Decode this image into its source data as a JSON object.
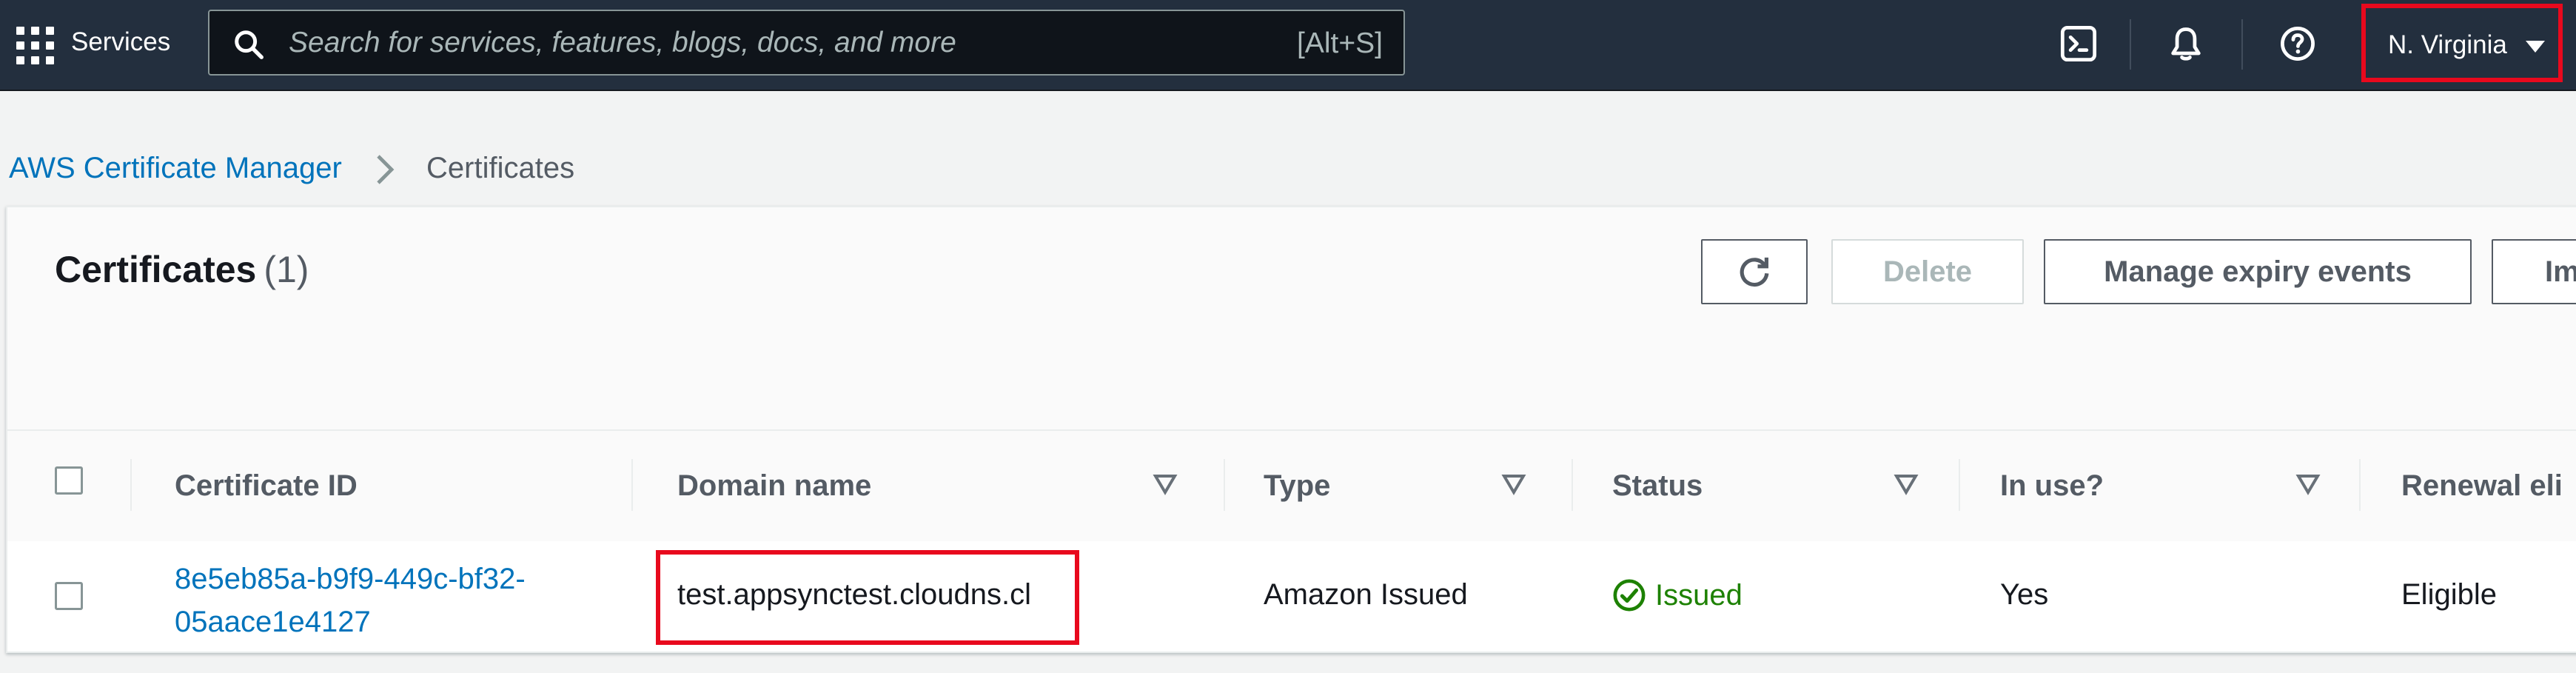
{
  "topnav": {
    "services_label": "Services",
    "search": {
      "placeholder": "Search for services, features, blogs, docs, and more",
      "shortcut": "[Alt+S]"
    },
    "icons": [
      "cloudshell-icon",
      "bell-icon",
      "help-icon"
    ],
    "region": "N. Virginia",
    "highlight_color": "#e8091d"
  },
  "breadcrumb": {
    "parent": "AWS Certificate Manager",
    "current": "Certificates"
  },
  "certificates": {
    "title": "Certificates",
    "count": "(1)",
    "buttons": {
      "delete": "Delete",
      "manage_expiry": "Manage expiry events",
      "import": "Im"
    },
    "columns": {
      "certificate_id": "Certificate ID",
      "domain_name": "Domain name",
      "type": "Type",
      "status": "Status",
      "in_use": "In use?",
      "renewal": "Renewal eli"
    },
    "rows": [
      {
        "id_line1": "8e5eb85a-b9f9-449c-bf32-",
        "id_line2": "05aace1e4127",
        "domain": "test.appsynctest.cloudns.cl",
        "type": "Amazon Issued",
        "status": "Issued",
        "status_color": "#1d8102",
        "in_use": "Yes",
        "renewal": "Eligible"
      }
    ]
  }
}
